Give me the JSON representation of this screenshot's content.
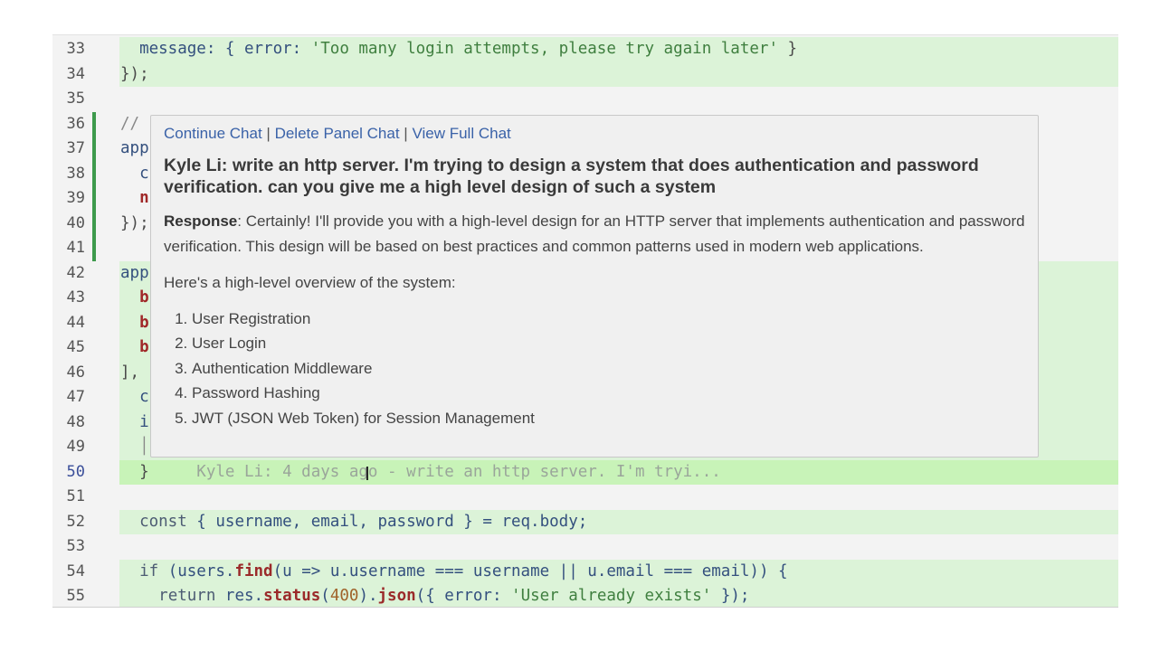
{
  "editor": {
    "lines": [
      {
        "n": "33",
        "state": "add",
        "tokens": [
          [
            "  message: { error: ",
            "t-id"
          ],
          [
            "'Too many login attempts, please try again later'",
            "t-str"
          ],
          [
            " }",
            "t-p"
          ]
        ]
      },
      {
        "n": "34",
        "state": "add",
        "tokens": [
          [
            "});",
            "t-p"
          ]
        ]
      },
      {
        "n": "35",
        "state": "",
        "tokens": []
      },
      {
        "n": "36",
        "state": "bar",
        "tokens": [
          [
            "// ",
            "t-cm"
          ]
        ]
      },
      {
        "n": "37",
        "state": "bar",
        "tokens": [
          [
            "app",
            "t-id"
          ]
        ]
      },
      {
        "n": "38",
        "state": "bar",
        "tokens": [
          [
            "  c",
            "t-id"
          ]
        ]
      },
      {
        "n": "39",
        "state": "bar",
        "tokens": [
          [
            "  n",
            "t-red"
          ]
        ]
      },
      {
        "n": "40",
        "state": "bar",
        "tokens": [
          [
            "});",
            "t-p"
          ]
        ]
      },
      {
        "n": "41",
        "state": "bar",
        "tokens": []
      },
      {
        "n": "42",
        "state": "add",
        "tokens": [
          [
            "app",
            "t-id"
          ]
        ]
      },
      {
        "n": "43",
        "state": "add",
        "tokens": [
          [
            "  b",
            "t-red"
          ]
        ]
      },
      {
        "n": "44",
        "state": "add",
        "tokens": [
          [
            "  b",
            "t-red"
          ]
        ]
      },
      {
        "n": "45",
        "state": "add",
        "tokens": [
          [
            "  b",
            "t-red"
          ]
        ]
      },
      {
        "n": "46",
        "state": "add",
        "tokens": [
          [
            "],",
            "t-p"
          ]
        ]
      },
      {
        "n": "47",
        "state": "add",
        "tokens": [
          [
            "  c",
            "t-id"
          ]
        ]
      },
      {
        "n": "48",
        "state": "add",
        "tokens": [
          [
            "  i",
            "t-id"
          ]
        ]
      },
      {
        "n": "49",
        "state": "add",
        "tokens": [
          [
            "  │",
            "t-cm"
          ]
        ]
      },
      {
        "n": "50",
        "state": "cur",
        "tokens": [
          [
            "  }",
            "t-p"
          ],
          [
            "     Kyle Li: 4 days ago - write an http server. I'm tryi...",
            "t-ghost"
          ]
        ]
      },
      {
        "n": "51",
        "state": "",
        "tokens": []
      },
      {
        "n": "52",
        "state": "add",
        "tokens": [
          [
            "  ",
            "t-p"
          ],
          [
            "const",
            "t-kw"
          ],
          [
            " { username, email, password } = req.body;",
            "t-id"
          ]
        ]
      },
      {
        "n": "53",
        "state": "",
        "tokens": []
      },
      {
        "n": "54",
        "state": "add",
        "tokens": [
          [
            "  ",
            "t-p"
          ],
          [
            "if",
            "t-kw"
          ],
          [
            " (users.",
            "t-id"
          ],
          [
            "find",
            "t-fn"
          ],
          [
            "(u => u.username === username || u.email === email)) {",
            "t-id"
          ]
        ]
      },
      {
        "n": "55",
        "state": "add",
        "tokens": [
          [
            "    ",
            "t-p"
          ],
          [
            "return",
            "t-kw"
          ],
          [
            " res.",
            "t-id"
          ],
          [
            "status",
            "t-fn"
          ],
          [
            "(",
            "t-id"
          ],
          [
            "400",
            "t-num"
          ],
          [
            ").",
            "t-id"
          ],
          [
            "json",
            "t-fn"
          ],
          [
            "({ error: ",
            "t-id"
          ],
          [
            "'User already exists'",
            "t-str"
          ],
          [
            " });",
            "t-id"
          ]
        ]
      }
    ]
  },
  "popup": {
    "links": [
      "Continue Chat",
      "Delete Panel Chat",
      "View Full Chat"
    ],
    "separator": "|",
    "title": "Kyle Li: write an http server. I'm trying to design a system that does authentication and password verification. can you give me a high level design of such a system",
    "response_label": "Response",
    "response_text": ": Certainly! I'll provide you with a high-level design for an HTTP server that implements authentication and password verification. This design will be based on best practices and common patterns used in modern web applications.",
    "overview": "Here's a high-level overview of the system:",
    "items": [
      "User Registration",
      "User Login",
      "Authentication Middleware",
      "Password Hashing",
      "JWT (JSON Web Token) for Session Management"
    ]
  },
  "icons": {
    "cursor": "text-cursor-icon"
  },
  "colors": {
    "added_line": "#dcf3d8",
    "current_line": "#c8f3b8",
    "gutter_bar": "#3d9a4c",
    "link": "#3a62a8"
  }
}
